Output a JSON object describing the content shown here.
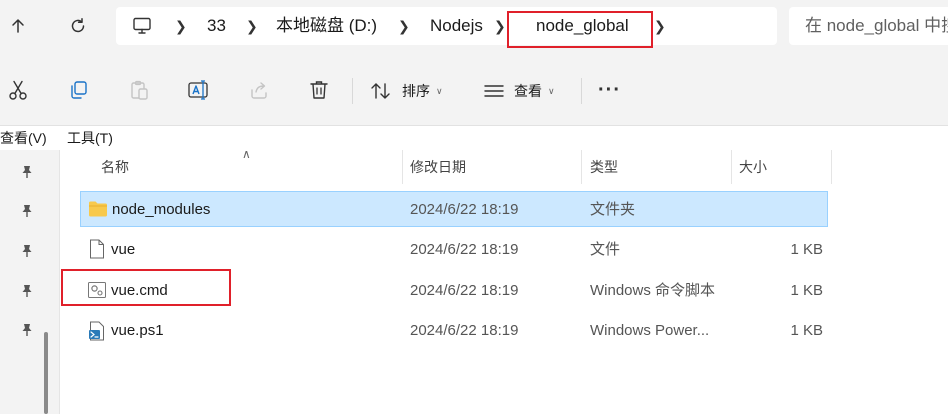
{
  "address_bar": {
    "crumbs": [
      "33",
      "本地磁盘 (D:)",
      "Nodejs",
      "node_global"
    ]
  },
  "search": {
    "placeholder": "在 node_global 中搜索"
  },
  "command_bar": {
    "icons": [
      "cut-icon",
      "copy-icon",
      "paste-icon",
      "rename-icon",
      "share-icon",
      "delete-icon"
    ],
    "sort_label": "排序",
    "view_label": "查看",
    "more_label": "···"
  },
  "menu": {
    "view": "查看(V)",
    "tools": "工具(T)"
  },
  "columns": {
    "name": "名称",
    "modified": "修改日期",
    "type": "类型",
    "size": "大小"
  },
  "files": [
    {
      "name": "node_modules",
      "modified": "2024/6/22 18:19",
      "type": "文件夹",
      "size": "",
      "icon": "folder-icon",
      "selected": true
    },
    {
      "name": "vue",
      "modified": "2024/6/22 18:19",
      "type": "文件",
      "size": "1 KB",
      "icon": "file-icon",
      "selected": false
    },
    {
      "name": "vue.cmd",
      "modified": "2024/6/22 18:19",
      "type": "Windows 命令脚本",
      "size": "1 KB",
      "icon": "cmd-script-icon",
      "selected": false
    },
    {
      "name": "vue.ps1",
      "modified": "2024/6/22 18:19",
      "type": "Windows Power...",
      "size": "1 KB",
      "icon": "powershell-script-icon",
      "selected": false
    }
  ],
  "colors": {
    "selection_bg": "#cce8ff",
    "selection_border": "#99d1ff",
    "highlight_box": "#e0202a",
    "folder": "#f8c94c"
  }
}
